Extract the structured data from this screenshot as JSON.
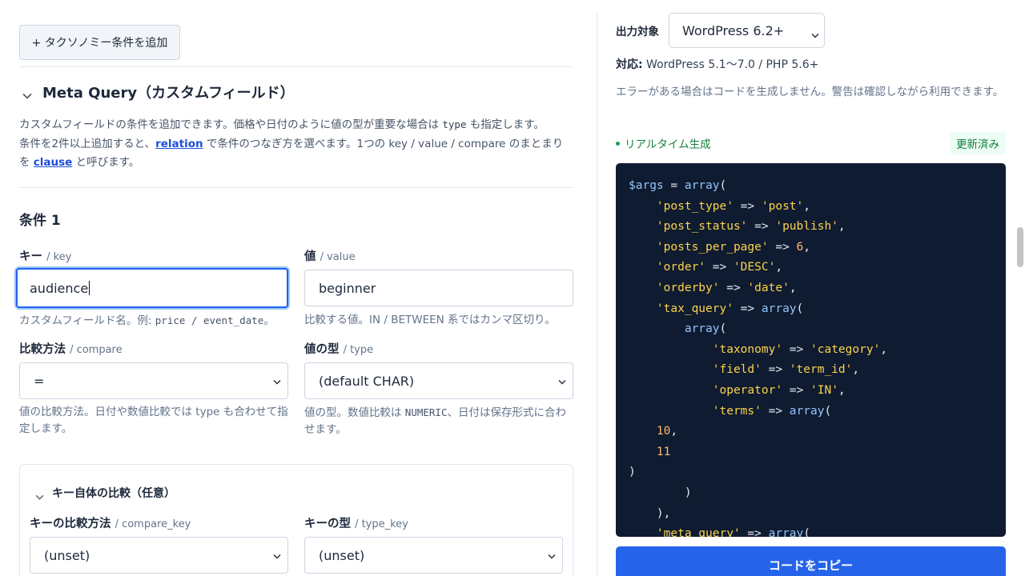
{
  "left": {
    "add_taxonomy_label": "+ タクソノミー条件を追加",
    "meta_query_title": "Meta Query（カスタムフィールド）",
    "desc": {
      "p1": "カスタムフィールドの条件を追加できます。価格や日付のように値の型が重要な場合は ",
      "code_type": "type",
      "p2": " も指定します。",
      "p3": "条件を2件以上追加すると、",
      "link_relation": "relation",
      "p4": " で条件のつなぎ方を選べます。1つの key / value / compare のまとまりを ",
      "link_clause": "clause",
      "p5": " と呼びます。"
    },
    "condition_title": "条件 1",
    "key": {
      "label": "キー",
      "label_en": "/ key",
      "value": "audience",
      "help_prefix": "カスタムフィールド名。例: ",
      "help_code": "price / event_date",
      "help_suffix": "。"
    },
    "value": {
      "label": "値",
      "label_en": "/ value",
      "value": "beginner",
      "help": "比較する値。IN / BETWEEN 系ではカンマ区切り。"
    },
    "compare": {
      "label": "比較方法",
      "label_en": "/ compare",
      "selected": "=",
      "help": "値の比較方法。日付や数値比較では type も合わせて指定します。"
    },
    "type": {
      "label": "値の型",
      "label_en": "/ type",
      "selected": "(default CHAR)",
      "help_prefix": "値の型。数値比較は ",
      "help_code": "NUMERIC",
      "help_suffix": "、日付は保存形式に合わせます。"
    },
    "key_compare_section": {
      "title": "キー自体の比較（任意）",
      "compare_key_label": "キーの比較方法",
      "compare_key_label_en": "/ compare_key",
      "compare_key_selected": "(unset)",
      "type_key_label": "キーの型",
      "type_key_label_en": "/ type_key",
      "type_key_selected": "(unset)"
    }
  },
  "right": {
    "target_label": "出力対象",
    "target_selected": "WordPress 6.2+",
    "compat_label": "対応:",
    "compat_value": " WordPress 5.1〜7.0 / PHP 5.6+",
    "note": "エラーがある場合はコードを生成しません。警告は確認しながら利用できます。",
    "realtime_label": "リアルタイム生成",
    "status_badge": "更新済み",
    "copy_button": "コードをコピー"
  },
  "code_lines": [
    [
      [
        "v",
        "$args"
      ],
      [
        "p",
        " = "
      ],
      [
        "v",
        "array"
      ],
      [
        "p",
        "("
      ]
    ],
    [
      [
        "p",
        "    "
      ],
      [
        "s",
        "'post_type'"
      ],
      [
        "p",
        " => "
      ],
      [
        "s",
        "'post'"
      ],
      [
        "p",
        ","
      ]
    ],
    [
      [
        "p",
        "    "
      ],
      [
        "s",
        "'post_status'"
      ],
      [
        "p",
        " => "
      ],
      [
        "s",
        "'publish'"
      ],
      [
        "p",
        ","
      ]
    ],
    [
      [
        "p",
        "    "
      ],
      [
        "s",
        "'posts_per_page'"
      ],
      [
        "p",
        " => "
      ],
      [
        "n",
        "6"
      ],
      [
        "p",
        ","
      ]
    ],
    [
      [
        "p",
        "    "
      ],
      [
        "s",
        "'order'"
      ],
      [
        "p",
        " => "
      ],
      [
        "s",
        "'DESC'"
      ],
      [
        "p",
        ","
      ]
    ],
    [
      [
        "p",
        "    "
      ],
      [
        "s",
        "'orderby'"
      ],
      [
        "p",
        " => "
      ],
      [
        "s",
        "'date'"
      ],
      [
        "p",
        ","
      ]
    ],
    [
      [
        "p",
        "    "
      ],
      [
        "s",
        "'tax_query'"
      ],
      [
        "p",
        " => "
      ],
      [
        "v",
        "array"
      ],
      [
        "p",
        "("
      ]
    ],
    [
      [
        "p",
        "        "
      ],
      [
        "v",
        "array"
      ],
      [
        "p",
        "("
      ]
    ],
    [
      [
        "p",
        "            "
      ],
      [
        "s",
        "'taxonomy'"
      ],
      [
        "p",
        " => "
      ],
      [
        "s",
        "'category'"
      ],
      [
        "p",
        ","
      ]
    ],
    [
      [
        "p",
        "            "
      ],
      [
        "s",
        "'field'"
      ],
      [
        "p",
        " => "
      ],
      [
        "s",
        "'term_id'"
      ],
      [
        "p",
        ","
      ]
    ],
    [
      [
        "p",
        "            "
      ],
      [
        "s",
        "'operator'"
      ],
      [
        "p",
        " => "
      ],
      [
        "s",
        "'IN'"
      ],
      [
        "p",
        ","
      ]
    ],
    [
      [
        "p",
        "            "
      ],
      [
        "s",
        "'terms'"
      ],
      [
        "p",
        " => "
      ],
      [
        "v",
        "array"
      ],
      [
        "p",
        "("
      ]
    ],
    [
      [
        "p",
        "    "
      ],
      [
        "n",
        "10"
      ],
      [
        "p",
        ","
      ]
    ],
    [
      [
        "p",
        "    "
      ],
      [
        "n",
        "11"
      ]
    ],
    [
      [
        "p",
        ")"
      ]
    ],
    [
      [
        "p",
        "        )"
      ]
    ],
    [
      [
        "p",
        "    ),"
      ]
    ],
    [
      [
        "p",
        "    "
      ],
      [
        "s",
        "'meta_query'"
      ],
      [
        "p",
        " => "
      ],
      [
        "v",
        "array"
      ],
      [
        "p",
        "("
      ]
    ]
  ],
  "colors": {
    "accent": "#2563eb",
    "code_bg": "#0f1b30",
    "success": "#15803d"
  }
}
